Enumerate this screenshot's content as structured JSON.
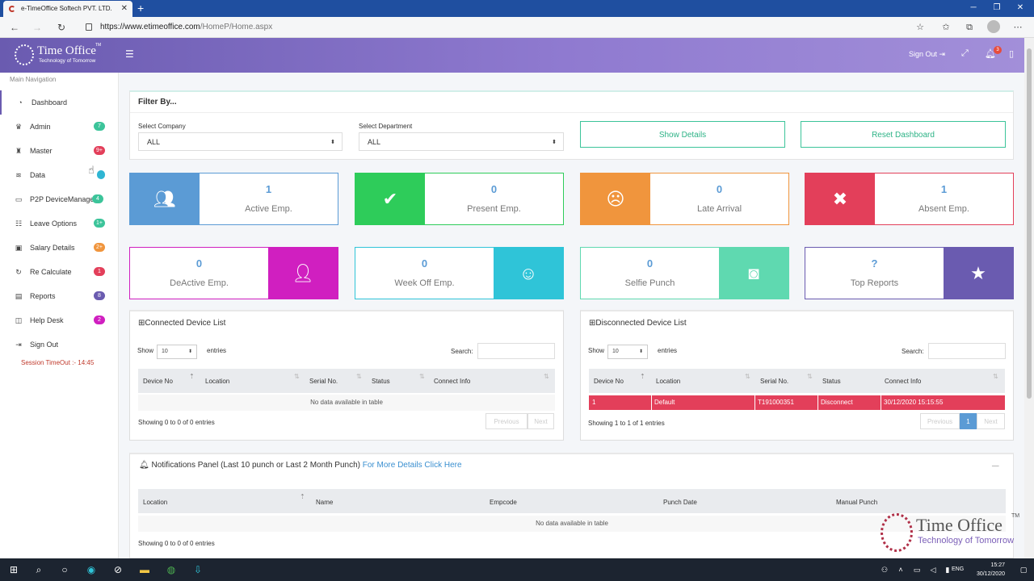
{
  "browser": {
    "tab_title": "e-TimeOffice Softech PVT. LTD.",
    "url_host": "https://www.etimeoffice.com",
    "url_path": "/HomeP/Home.aspx"
  },
  "header": {
    "logo_title": "Time Office",
    "logo_tm": "TM",
    "logo_tagline": "Technology of Tomorrow",
    "signout_label": "Sign Out",
    "bell_count": "3"
  },
  "sidebar": {
    "heading": "Main Navigation",
    "items": [
      {
        "label": "Dashboard",
        "badge": "",
        "icon": "dashboard-icon"
      },
      {
        "label": "Admin",
        "badge": "7",
        "badge_color": "#3cc49a",
        "icon": "admin-icon"
      },
      {
        "label": "Master",
        "badge": "9+",
        "badge_color": "#e33f5a",
        "icon": "master-icon"
      },
      {
        "label": "Data",
        "badge": "",
        "badge_color": "#2fb5d3",
        "icon": "database-icon"
      },
      {
        "label": "P2P DeviceManage",
        "badge": "4",
        "badge_color": "#3cc49a",
        "icon": "monitor-icon"
      },
      {
        "label": "Leave Options",
        "badge": "1+",
        "badge_color": "#3cc49a",
        "icon": "list-icon"
      },
      {
        "label": "Salary Details",
        "badge": "2+",
        "badge_color": "#f0953d",
        "icon": "money-icon"
      },
      {
        "label": "Re Calculate",
        "badge": "1",
        "badge_color": "#e33f5a",
        "icon": "refresh-icon"
      },
      {
        "label": "Reports",
        "badge": "8",
        "badge_color": "#6a5bb0",
        "icon": "reports-icon"
      },
      {
        "label": "Help Desk",
        "badge": "2",
        "badge_color": "#d01fc0",
        "icon": "help-icon"
      },
      {
        "label": "Sign Out",
        "badge": "",
        "icon": "signout-icon"
      }
    ],
    "session_timeout": "Session TimeOut :- 14:45"
  },
  "filter": {
    "title": "Filter By...",
    "company_label": "Select Company",
    "company_value": "ALL",
    "department_label": "Select Department",
    "department_value": "ALL",
    "show_details": "Show Details",
    "reset_dashboard": "Reset Dashboard"
  },
  "cards": [
    {
      "value": "1",
      "label": "Active Emp.",
      "color": "#5b9bd5",
      "icon": "users-icon"
    },
    {
      "value": "0",
      "label": "Present Emp.",
      "color": "#2ecc5a",
      "icon": "check-icon"
    },
    {
      "value": "0",
      "label": "Late Arrival",
      "color": "#f0953d",
      "icon": "sad-face-icon"
    },
    {
      "value": "1",
      "label": "Absent Emp.",
      "color": "#e33f5a",
      "icon": "close-icon"
    },
    {
      "value": "0",
      "label": "DeActive Emp.",
      "color": "#d01fc0",
      "icon": "user-remove-icon"
    },
    {
      "value": "0",
      "label": "Week Off Emp.",
      "color": "#2fc4d8",
      "icon": "smile-icon"
    },
    {
      "value": "0",
      "label": "Selfie Punch",
      "color": "#5fd9b0",
      "icon": "camera-icon"
    },
    {
      "value": "?",
      "label": "Top Reports",
      "color": "#6a5bb0",
      "icon": "star-icon"
    }
  ],
  "connected": {
    "title": "Connected Device List",
    "show": "Show",
    "entries_select": "10",
    "entries": "entries",
    "search": "Search:",
    "columns": [
      "Device No",
      "Location",
      "Serial No.",
      "Status",
      "Connect Info"
    ],
    "empty": "No data available in table",
    "info": "Showing 0 to 0 of 0 entries",
    "prev": "Previous",
    "next": "Next"
  },
  "disconnected": {
    "title": "Disconnected Device List",
    "show": "Show",
    "entries_select": "10",
    "entries": "entries",
    "search": "Search:",
    "columns": [
      "Device No",
      "Location",
      "Serial No.",
      "Status",
      "Connect Info"
    ],
    "row": [
      "1",
      "Default",
      "T191000351",
      "Disconnect",
      "30/12/2020 15:15:55"
    ],
    "info": "Showing 1 to 1 of 1 entries",
    "prev": "Previous",
    "page": "1",
    "next": "Next"
  },
  "notifications": {
    "title": "Notifications Panel (Last 10 punch or Last 2 Month Punch)",
    "link": "For More Details Click Here",
    "columns": [
      "Location",
      "Name",
      "Empcode",
      "Punch Date",
      "Manual Punch"
    ],
    "empty": "No data available in table",
    "info": "Showing 0 to 0 of 0 entries"
  },
  "watermark": {
    "title": "Time Office",
    "tagline": "Technology of Tomorrow",
    "tm": "TM"
  },
  "taskbar": {
    "lang": "ENG",
    "time": "15:27",
    "date": "30/12/2020"
  }
}
